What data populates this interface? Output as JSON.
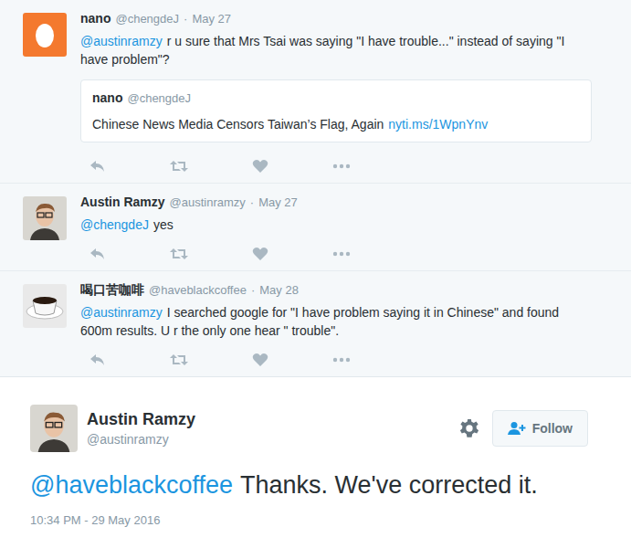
{
  "separator": "·",
  "replies": [
    {
      "kind": "egg",
      "name": "nano",
      "handle": "@chengdeJ",
      "date": "May 27",
      "mention": "@austinramzy",
      "text": "r u sure that Mrs Tsai was saying \"I have trouble...\" instead of saying \"I have problem\"?",
      "quote": {
        "name": "nano",
        "handle": "@chengdeJ",
        "text": "Chinese News Media Censors Taiwan’s Flag, Again",
        "link": "nyti.ms/1WpnYnv"
      }
    },
    {
      "kind": "person",
      "name": "Austin Ramzy",
      "handle": "@austinramzy",
      "date": "May 27",
      "mention": "@chengdeJ",
      "text": "yes",
      "quote": null
    },
    {
      "kind": "coffee",
      "name": "喝口苦咖啡",
      "handle": "@haveblackcoffee",
      "date": "May 28",
      "mention": "@austinramzy",
      "text": "I searched google for  \"I have problem saying it in Chinese\" and found 600m results. U r the only one hear \" trouble\".",
      "quote": null
    }
  ],
  "main": {
    "name": "Austin Ramzy",
    "handle": "@austinramzy",
    "follow": "Follow",
    "mention": "@haveblackcoffee",
    "text": "Thanks. We've corrected it.",
    "time": "10:34 PM - 29 May 2016"
  }
}
